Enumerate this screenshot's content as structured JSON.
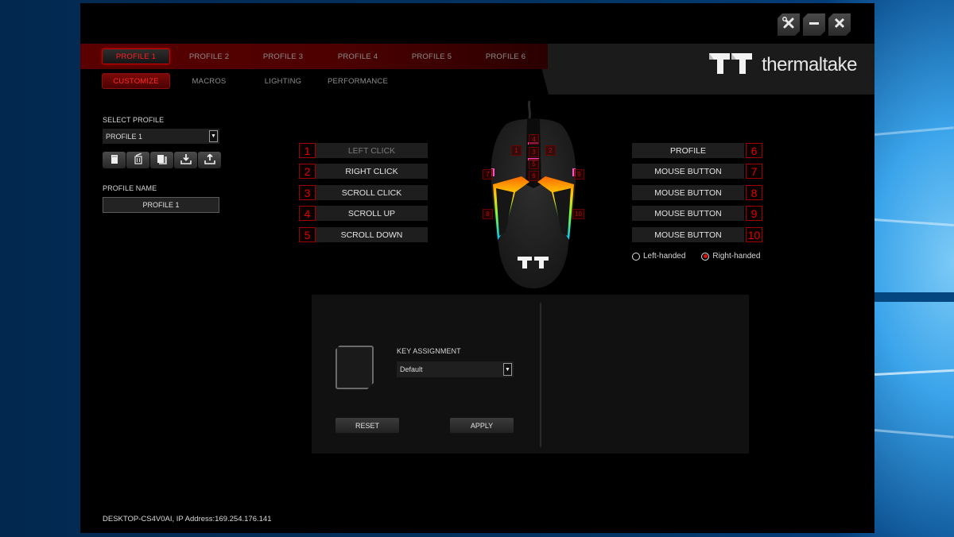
{
  "window": {
    "brand": "thermaltake",
    "controls": [
      {
        "name": "settings",
        "icon": "tools-icon",
        "glyph": "✂"
      },
      {
        "name": "minimize",
        "icon": "minimize-icon",
        "glyph": "—"
      },
      {
        "name": "close",
        "icon": "close-icon",
        "glyph": "✕"
      }
    ]
  },
  "profile_tabs": [
    "PROFILE 1",
    "PROFILE 2",
    "PROFILE 3",
    "PROFILE 4",
    "PROFILE 5",
    "PROFILE 6"
  ],
  "active_profile_tab": 0,
  "sub_tabs": [
    "CUSTOMIZE",
    "MACROS",
    "LIGHTING",
    "PERFORMANCE"
  ],
  "active_sub_tab": 0,
  "sidebar": {
    "select_profile_label": "SELECT PROFILE",
    "select_profile_value": "PROFILE 1",
    "actions": [
      {
        "name": "new-profile",
        "icon": "new-file-icon"
      },
      {
        "name": "delete-profile",
        "icon": "trash-icon"
      },
      {
        "name": "copy-profile",
        "icon": "copy-icon"
      },
      {
        "name": "import-profile",
        "icon": "import-icon"
      },
      {
        "name": "export-profile",
        "icon": "export-icon"
      }
    ],
    "profile_name_label": "PROFILE NAME",
    "profile_name_value": "PROFILE 1"
  },
  "buttons_left": [
    {
      "num": "1",
      "label": "LEFT CLICK",
      "dim": true
    },
    {
      "num": "2",
      "label": "RIGHT CLICK",
      "dim": false
    },
    {
      "num": "3",
      "label": "SCROLL CLICK",
      "dim": false
    },
    {
      "num": "4",
      "label": "SCROLL UP",
      "dim": false
    },
    {
      "num": "5",
      "label": "SCROLL DOWN",
      "dim": false
    }
  ],
  "buttons_right": [
    {
      "num": "6",
      "label": "PROFILE"
    },
    {
      "num": "7",
      "label": "MOUSE BUTTON"
    },
    {
      "num": "8",
      "label": "MOUSE BUTTON"
    },
    {
      "num": "9",
      "label": "MOUSE BUTTON"
    },
    {
      "num": "10",
      "label": "MOUSE BUTTON"
    }
  ],
  "handedness": {
    "left_label": "Left-handed",
    "right_label": "Right-handed",
    "selected": "right"
  },
  "mouse_markers": [
    "1",
    "2",
    "3",
    "4",
    "5",
    "6",
    "7",
    "8",
    "9",
    "10"
  ],
  "assignment_panel": {
    "key_assignment_label": "KEY ASSIGNMENT",
    "key_assignment_value": "Default",
    "reset_label": "RESET",
    "apply_label": "APPLY"
  },
  "status_bar": "DESKTOP-CS4V0AI, IP Address:169.254.176.141",
  "colors": {
    "accent_red": "#e00000",
    "profile_band": "#4d0000",
    "background": "#000000",
    "panel": "#111111"
  }
}
